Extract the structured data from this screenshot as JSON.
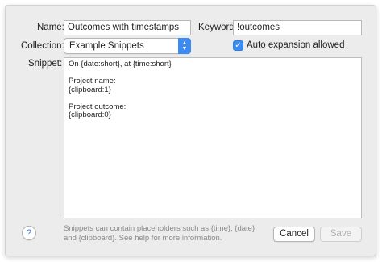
{
  "form": {
    "name_label": "Name:",
    "name_value": "Outcomes with timestamps",
    "keyword_label": "Keyword:",
    "keyword_value": "!outcomes",
    "collection_label": "Collection:",
    "collection_value": "Example Snippets",
    "auto_expansion_label": "Auto expansion allowed",
    "auto_expansion_checked": true,
    "snippet_label": "Snippet:",
    "snippet_lines": [
      "On {date:short}, at {time:short}",
      "",
      "Project name:",
      "{clipboard:1}",
      "",
      "Project outcome:",
      "{clipboard:0}"
    ]
  },
  "footer": {
    "help_glyph": "?",
    "hint_line1": "Snippets can contain placeholders such as {time}, {date}",
    "hint_line2": "and {clipboard}. See help for more information.",
    "cancel_label": "Cancel",
    "save_label": "Save",
    "save_enabled": false
  },
  "colors": {
    "accent": "#3a8cf4",
    "panel_bg": "#ececec"
  },
  "icons": {
    "popup_arrows": "chevron-up-down-icon",
    "checkbox_check": "checkmark-icon",
    "help": "help-icon"
  }
}
